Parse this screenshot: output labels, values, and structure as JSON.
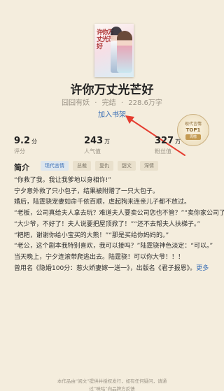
{
  "book": {
    "cover_title": "许你万丈光芒好",
    "title": "许你万丈光芒好",
    "author": "囧囧有妖",
    "status": "完结",
    "word_count": "228.6万字",
    "add_to_shelf": "加入书架"
  },
  "rank_badge": {
    "line1": "现代言情",
    "line2": "TOP1",
    "line3": "周榜"
  },
  "stats": [
    {
      "value": "9.2",
      "unit": "分",
      "label": "评分"
    },
    {
      "value": "243",
      "unit": "万",
      "label": "人气值"
    },
    {
      "value": "327",
      "unit": "万",
      "label": "粉丝值"
    }
  ],
  "intro": {
    "heading": "简介",
    "tags": [
      "现代言情",
      "总裁",
      "复仇",
      "甜文",
      "深情"
    ],
    "lines": [
      "“你救了我，我让我爹地以身相许!”",
      "宁夕意外救了只小包子，结果被附赠了一只大包子。",
      "婚后，陆霆骁宠妻如命千依百顺，虐起狗来连亲儿子都不放过。",
      "“老板，公司真给夫人拿去玩？难道夫人要卖公司您也不管？”“卖你家公司了？”",
      "“大少爷，不好了！夫人说要把屋顶掀了！”“还不去帮夫人扶梯子。”",
      "“粑粑，谢谢你给小宝买的大熊！”“那是买给你妈妈的。”",
      "“老公，这个剧本我特别喜欢，我可以接吗？”陆霆骁神色淡定：“可以。”",
      "当天晚上，宁夕连滚带爬逃出去。陆霆骁！可以你大爷！！！",
      "曾用名《隐婚100分：惹火娇妻嫁一送一》，出版名《君子报恩》。"
    ],
    "more": "更多"
  },
  "footer": {
    "line1": "本作品由“阅文”提供并授权发行，如有任何疑问，请通",
    "line2": "过“咪咕”向品牌方反馈"
  },
  "colors": {
    "background": "#f4eddd",
    "link": "#3a6fb6",
    "arrow": "#e53d30"
  }
}
